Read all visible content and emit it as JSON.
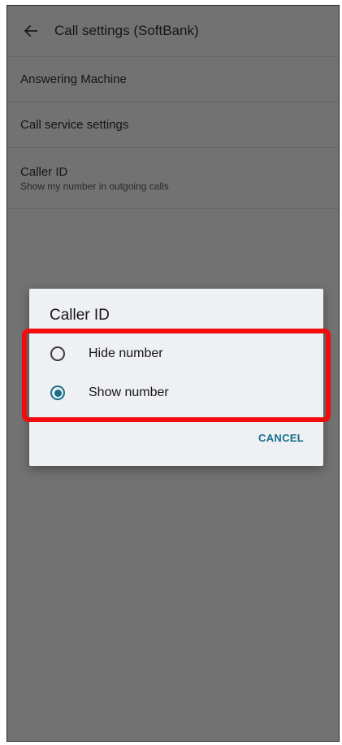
{
  "app_bar": {
    "title": "Call settings (SoftBank)",
    "back_icon": "arrow-left-icon"
  },
  "settings": {
    "items": [
      {
        "title": "Answering Machine"
      },
      {
        "title": "Call service settings"
      },
      {
        "title": "Caller ID",
        "summary": "Show my number in outgoing calls"
      }
    ]
  },
  "dialog": {
    "title": "Caller ID",
    "options": [
      {
        "label": "Hide number",
        "selected": false
      },
      {
        "label": "Show number",
        "selected": true
      }
    ],
    "cancel_label": "CANCEL"
  },
  "colors": {
    "accent": "#17708a",
    "highlight": "#f20d0d",
    "scrim_background": "#727272",
    "dialog_background": "#eef0f3"
  }
}
